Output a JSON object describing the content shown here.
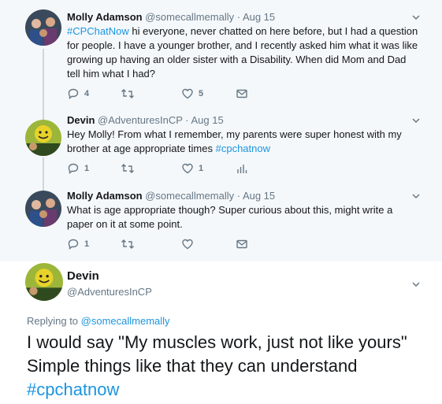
{
  "colors": {
    "accent": "#1b95e0",
    "muted": "#657786",
    "thread_bg": "#f5f8fa"
  },
  "tweets": [
    {
      "name": "Molly Adamson",
      "handle": "@somecallmemally · Aug 15",
      "hashtag": "#CPChatNow",
      "text": " hi everyone, never chatted on here before, but I had a question for people. I have a younger brother, and I recently asked him what it was like growing up having an older sister with a Disability. When did Mom and Dad tell him what I had?",
      "reply_count": "4",
      "like_count": "5"
    },
    {
      "name": "Devin",
      "handle": "@AdventuresInCP · Aug 15",
      "text": "Hey Molly! From what I remember, my parents were super honest with my brother at age appropriate times ",
      "hashtag": "#cpchatnow",
      "reply_count": "1",
      "like_count": "1"
    },
    {
      "name": "Molly Adamson",
      "handle": "@somecallmemally · Aug 15",
      "text": "What is age appropriate though? Super curious about this, might write a paper on it at some point.",
      "reply_count": "1"
    }
  ],
  "main_tweet": {
    "name": "Devin",
    "handle": "@AdventuresInCP",
    "replying_prefix": "Replying to ",
    "replying_handle": "@somecallmemally",
    "text": "I would say \"My muscles work, just not like yours\" Simple things like that they can understand ",
    "hashtag": "#cpchatnow"
  }
}
